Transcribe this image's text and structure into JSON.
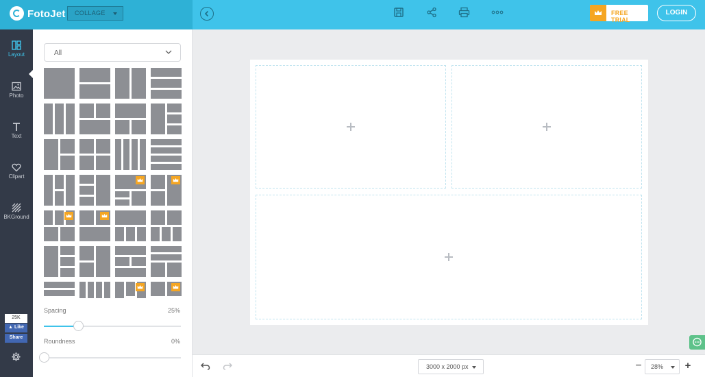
{
  "app": {
    "name": "FotoJet",
    "mode": "COLLAGE",
    "free_trial_label": "FREE TRIAL",
    "login_label": "LOGIN"
  },
  "colors": {
    "brand": "#2eb1d6",
    "topbar": "#3fc3ea",
    "nav_bg": "#333a48",
    "accent_gold": "#f5a623",
    "tile_gray": "#8d8f94"
  },
  "toolbar": {
    "icons": [
      "save-icon",
      "share-icon",
      "print-icon",
      "more-icon"
    ]
  },
  "nav": {
    "items": [
      {
        "label": "Layout",
        "icon": "layout-icon"
      },
      {
        "label": "Photo",
        "icon": "photo-icon"
      },
      {
        "label": "Text",
        "icon": "text-icon"
      },
      {
        "label": "Clipart",
        "icon": "heart-icon"
      },
      {
        "label": "BKGround",
        "icon": "background-icon"
      }
    ],
    "fb_count": "25K",
    "fb_like": "Like",
    "fb_share": "Share"
  },
  "panel": {
    "category": "All",
    "spacing_label": "Spacing",
    "spacing_value": "25%",
    "spacing_level": 0.25,
    "roundness_label": "Roundness",
    "roundness_value": "0%",
    "roundness_level": 0
  },
  "footer": {
    "canvas_size": "3000 x 2000 px",
    "zoom": "28%"
  }
}
